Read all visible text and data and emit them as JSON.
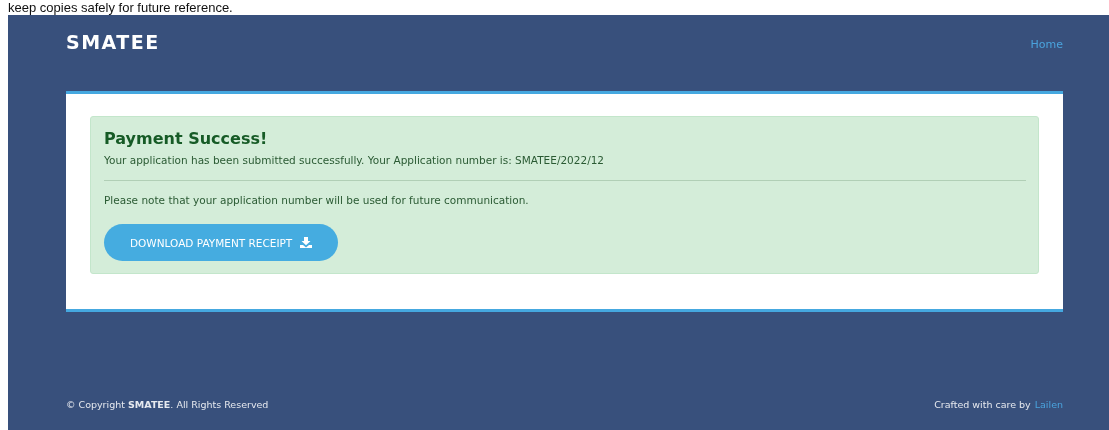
{
  "top_note": "keep copies safely for future reference.",
  "header": {
    "logo": "SMATEE",
    "nav": [
      {
        "label": "Home"
      }
    ]
  },
  "alert": {
    "title": "Payment Success!",
    "message": "Your application has been submitted successfully. Your Application number is: SMATEE/2022/12",
    "note": "Please note that your application number will be used for future communication.",
    "button": "DOWNLOAD PAYMENT RECEIPT"
  },
  "footer": {
    "copyright": "© Copyright **SMATEE**. All Rights Reserved",
    "credit": "Crafted with care by",
    "credit_link": "Lailen"
  }
}
